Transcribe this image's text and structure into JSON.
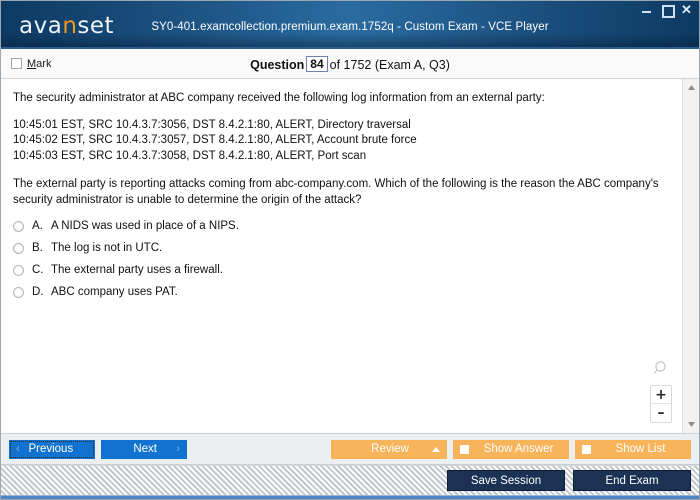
{
  "window": {
    "title": "SY0-401.examcollection.premium.exam.1752q - Custom Exam - VCE Player",
    "brand_prefix": "ava",
    "brand_accent": "n",
    "brand_suffix": "set",
    "controls": {
      "minimize": "minimize-icon",
      "maximize": "maximize-icon",
      "close": "✕"
    }
  },
  "question_bar": {
    "mark_label_accel": "M",
    "mark_label_rest": "ark",
    "counter_word": "Question",
    "counter_number": "84",
    "counter_rest": "of 1752 (Exam A, Q3)"
  },
  "question": {
    "intro": "The security administrator at ABC company received the following log information from an external party:",
    "log_lines": [
      "10:45:01 EST, SRC 10.4.3.7:3056, DST 8.4.2.1:80, ALERT, Directory traversal",
      "10:45:02 EST, SRC 10.4.3.7:3057, DST 8.4.2.1:80, ALERT, Account brute force",
      "10:45:03 EST, SRC 10.4.3.7:3058, DST 8.4.2.1:80, ALERT, Port scan"
    ],
    "prompt": "The external party is reporting attacks coming from abc-company.com. Which of the following is the reason the ABC company's security administrator is unable to determine the origin of the attack?",
    "options": [
      {
        "letter": "A.",
        "text": "A NIDS was used in place of a NIPS.",
        "selected": false
      },
      {
        "letter": "B.",
        "text": "The log is not in UTC.",
        "selected": false
      },
      {
        "letter": "C.",
        "text": "The external party uses a firewall.",
        "selected": false
      },
      {
        "letter": "D.",
        "text": "ABC company uses PAT.",
        "selected": false
      }
    ]
  },
  "zoom_widget": {
    "magnifier": "magnifier-icon",
    "zoom_in": "+",
    "zoom_out": "–"
  },
  "scrollbar": {
    "up_arrow": "scroll-up-icon",
    "down_arrow": "scroll-down-icon"
  },
  "action_bar": {
    "previous_label": "Previous",
    "previous_chevron": "‹",
    "next_label": "Next",
    "next_chevron": "›",
    "review_label": "Review",
    "show_answer_label": "Show Answer",
    "show_list_label": "Show List"
  },
  "status_bar": {
    "save_session_label": "Save Session",
    "end_exam_label": "End Exam"
  },
  "colors": {
    "title_bar_dark": "#0d3a63",
    "title_bar_light": "#2a6ba0",
    "brand_accent": "#f0991f",
    "nav_blue": "#1272cf",
    "orange": "#f7b45a",
    "navy_button": "#1c3254",
    "bottom_accent": "#4a86c5"
  }
}
